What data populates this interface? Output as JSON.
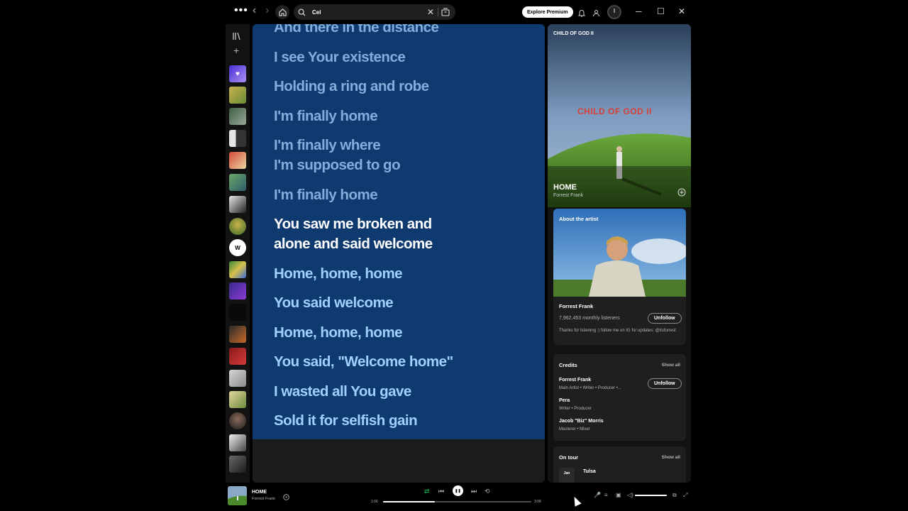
{
  "topbar": {
    "menu_glyph": "•••",
    "back_glyph": "‹",
    "forward_glyph": "›",
    "search": {
      "value": "Cel"
    },
    "clear_glyph": "✕",
    "premium_label": "Explore Premium",
    "minimize_glyph": "─",
    "maximize_glyph": "☐",
    "close_glyph": "✕"
  },
  "sidebar": {
    "create_glyph": "+",
    "liked_glyph": "♥",
    "icons": [
      "library-icon",
      "plus-icon",
      "heart-icon"
    ]
  },
  "lyrics": {
    "lines": [
      {
        "text": "And there in the distance",
        "state": "past"
      },
      {
        "text": "I see Your existence",
        "state": "past"
      },
      {
        "text": "Holding a ring and robe",
        "state": "past"
      },
      {
        "text": "I'm finally home",
        "state": "past"
      },
      {
        "text": "I'm finally where\nI'm supposed to go",
        "state": "past"
      },
      {
        "text": "I'm finally home",
        "state": "past"
      },
      {
        "text": "You saw me broken and\nalone and said welcome",
        "state": "active"
      },
      {
        "text": "Home, home, home",
        "state": "upcoming"
      },
      {
        "text": "You said welcome",
        "state": "upcoming"
      },
      {
        "text": "Home, home, home",
        "state": "upcoming"
      },
      {
        "text": "You said, \"Welcome home\"",
        "state": "upcoming"
      },
      {
        "text": "I wasted all You gave",
        "state": "upcoming"
      },
      {
        "text": "Sold it for selfish gain",
        "state": "upcoming"
      }
    ],
    "background_color": "#0e3a6f"
  },
  "now_playing_panel": {
    "album_title": "CHILD OF GOD II",
    "album_art_text": "CHILD OF GOD II",
    "track_title": "HOME",
    "track_artist": "Forrest Frank",
    "about": {
      "heading": "About the artist",
      "artist_name": "Forrest Frank",
      "monthly_listeners": "7,962,453 monthly listeners",
      "unfollow_label": "Unfollow",
      "bio": "Thanks for listening :) follow me on IG for updates: @itsforrest"
    },
    "credits": {
      "heading": "Credits",
      "show_all_label": "Show all",
      "unfollow_label": "Unfollow",
      "people": [
        {
          "name": "Forrest Frank",
          "role": "Main Artist • Writer • Producer •..."
        },
        {
          "name": "Pera",
          "role": "Writer • Producer"
        },
        {
          "name": "Jacob \"Biz\" Morris",
          "role": "Masterer • Mixer"
        }
      ]
    },
    "tour": {
      "heading": "On tour",
      "show_all_label": "Show all",
      "date_label": "Jan",
      "city": "Tulsa"
    }
  },
  "player": {
    "title": "HOME",
    "artist": "Forrest Frank",
    "elapsed": "1:06",
    "total": "3:08",
    "progress_fraction": 0.35,
    "volume_fraction": 1.0,
    "shuffle_glyph": "⇄",
    "prev_glyph": "⏮",
    "next_glyph": "⏭",
    "repeat_glyph": "⟲",
    "pause_glyph": "❚❚",
    "lyrics_glyph": "🎤",
    "queue_glyph": "≡",
    "devices_glyph": "▣",
    "volume_glyph": "◁)",
    "miniplayer_glyph": "⧉",
    "fullscreen_glyph": "⤢",
    "accent_color": "#1db954"
  }
}
